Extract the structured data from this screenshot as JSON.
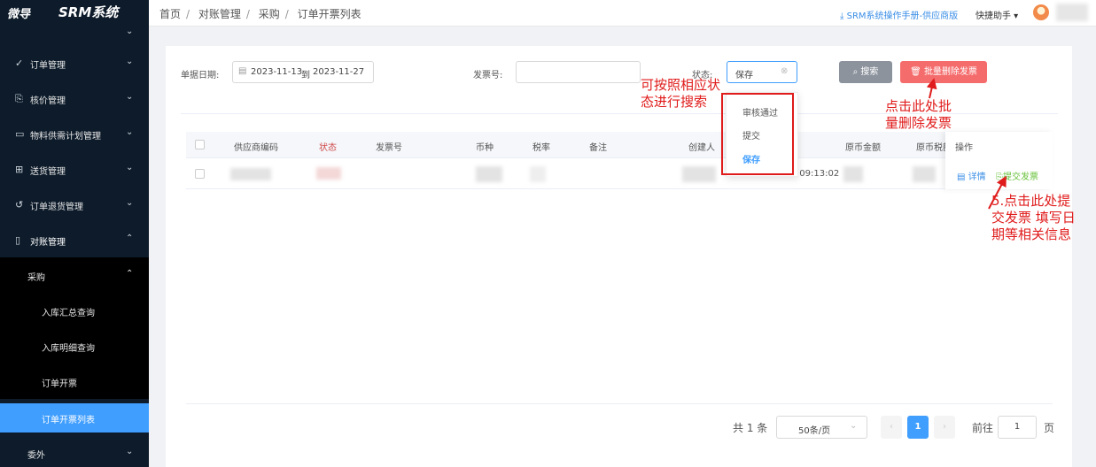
{
  "brand": {
    "logo": "微导",
    "system": "SRM系统"
  },
  "breadcrumb": [
    "首页",
    "对账管理",
    "采购",
    "订单开票列表"
  ],
  "header": {
    "manual_link": "⤓ SRM系统操作手册-供应商版",
    "quick_helper": "快捷助手 ▾"
  },
  "sidebar": {
    "items": [
      {
        "icon": "✓",
        "label": "订单管理",
        "arrow": "⌄"
      },
      {
        "icon": "⎘",
        "label": "核价管理",
        "arrow": "⌄"
      },
      {
        "icon": "▭",
        "label": "物料供需计划管理",
        "arrow": "⌄"
      },
      {
        "icon": "⊞",
        "label": "送货管理",
        "arrow": "⌄"
      },
      {
        "icon": "↺",
        "label": "订单退货管理",
        "arrow": "⌄"
      },
      {
        "icon": "▯",
        "label": "对账管理",
        "arrow": "⌃"
      }
    ],
    "sub_group": {
      "label": "采购",
      "arrow": "⌃"
    },
    "sub_items": [
      "入库汇总查询",
      "入库明细查询",
      "订单开票",
      "订单开票列表"
    ],
    "last_item": {
      "label": "委外",
      "arrow": "⌄"
    }
  },
  "filters": {
    "date_label": "单据日期:",
    "date_start": "2023-11-13",
    "date_to": "到",
    "date_end": "2023-11-27",
    "invoice_label": "发票号:",
    "invoice_value": "",
    "status_label": "状态:",
    "status_value": "保存",
    "search_button": "搜索",
    "batch_delete_button": "批量删除发票"
  },
  "status_options": [
    "审核通过",
    "提交",
    "保存"
  ],
  "table": {
    "columns": [
      "供应商编码",
      "状态",
      "发票号",
      "币种",
      "税率",
      "备注",
      "创建人",
      "原币金额",
      "原币税额",
      "操作"
    ],
    "rows": [
      {
        "created_time": "2023-11-27 09:13:02",
        "actions": [
          "详情",
          "提交发票"
        ]
      }
    ]
  },
  "annotations": {
    "status_hint": "可按照相应状\n态进行搜索",
    "delete_hint": "点击此处批\n量删除发票",
    "submit_hint": "5.点击此处提\n交发票 填写日\n期等相关信息"
  },
  "pagination": {
    "total": "共 1 条",
    "page_size": "50条/页",
    "current": "1",
    "goto_label": "前往",
    "goto_value": "1",
    "page_suffix": "页"
  },
  "colors": {
    "accent": "#409eff",
    "danger": "#f56c6c",
    "annotation": "#e01b1b",
    "sidebar": "#0d1b2a"
  }
}
